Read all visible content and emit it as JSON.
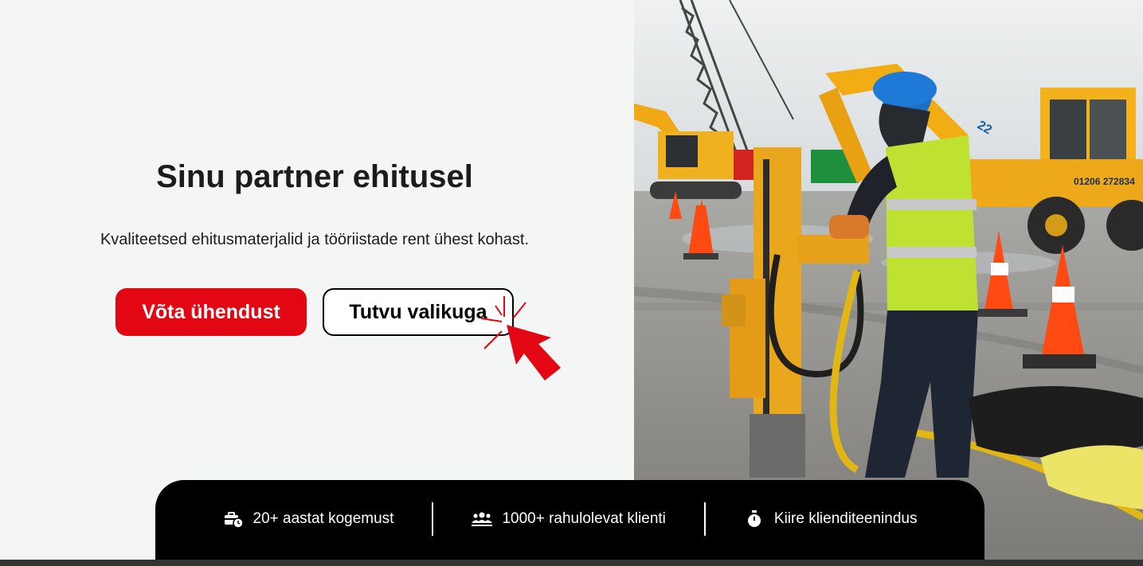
{
  "hero": {
    "title": "Sinu partner ehitusel",
    "subtitle": "Kvaliteetsed ehitusmaterjalid ja tööriistade rent ühest kohast.",
    "primary_button": "Võta ühendust",
    "secondary_button": "Tutvu valikuga"
  },
  "stats": [
    {
      "icon": "toolbox-clock-icon",
      "label": "20+ aastat kogemust"
    },
    {
      "icon": "users-icon",
      "label": "1000+ rahulolevat klienti"
    },
    {
      "icon": "stopwatch-icon",
      "label": "Kiire klienditeenindus"
    }
  ],
  "photo": {
    "excavator_text": "01206 272834",
    "excavator_number": "22"
  },
  "colors": {
    "accent": "#e30613",
    "background": "#f4f6f6",
    "stats_bar": "#000000",
    "cone": "#ff4a12",
    "machinery": "#f3b21b"
  }
}
